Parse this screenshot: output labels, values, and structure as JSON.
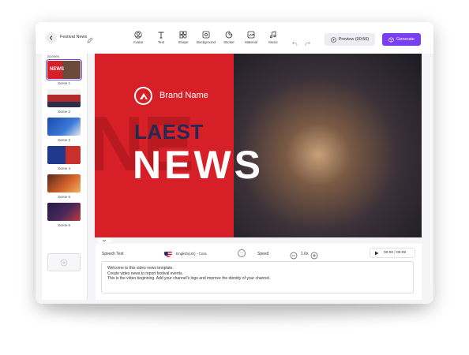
{
  "toolbar": {
    "project_name": "Festival News",
    "tools": [
      {
        "label": "Avatar",
        "icon": "avatar-icon"
      },
      {
        "label": "Text",
        "icon": "text-icon"
      },
      {
        "label": "Shape",
        "icon": "shape-icon"
      },
      {
        "label": "Background",
        "icon": "background-icon"
      },
      {
        "label": "Sticker",
        "icon": "sticker-icon"
      },
      {
        "label": "Material",
        "icon": "material-icon"
      },
      {
        "label": "Music",
        "icon": "music-icon"
      }
    ],
    "preview_label": "Preview (00:56)",
    "generate_label": "Generate"
  },
  "sidebar": {
    "title": "Scenes",
    "scenes": [
      {
        "label": "Scene 1",
        "active": true
      },
      {
        "label": "Scene 2",
        "active": false
      },
      {
        "label": "Scene 3",
        "active": false
      },
      {
        "label": "Scene 4",
        "active": false
      },
      {
        "label": "Scene 5",
        "active": false
      },
      {
        "label": "Scene 6",
        "active": false
      }
    ]
  },
  "stage": {
    "brand_name": "Brand Name",
    "headline_top": "LAEST",
    "headline_main": "NEWS",
    "background_letters": "NE",
    "thumb_badge": "NEWS"
  },
  "speech": {
    "label": "Speech Text",
    "voice": "English(US) - Cora",
    "speed_label": "Speed",
    "speed_value": "1.0x",
    "time": "00:00 / 00:09",
    "script_lines": [
      "Welcome to this video news template.",
      "Create video news to report festival events.",
      "This is the video beginning. Add your channel's logo and improve the identity of your channel."
    ]
  },
  "colors": {
    "accent": "#7b3ff2",
    "brand_red": "#d61f26",
    "headline_navy": "#222a52"
  }
}
